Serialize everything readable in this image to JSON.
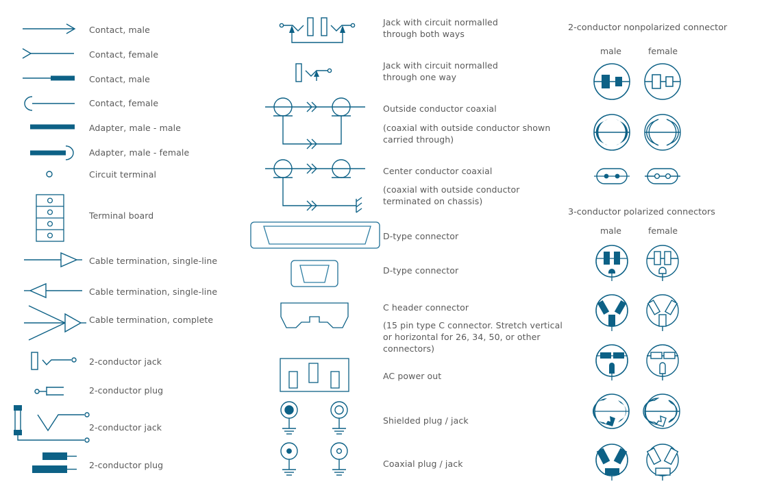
{
  "palette": {
    "symbol_stroke": "#0d6186",
    "symbol_fill": "#0d6186",
    "text": "#595959",
    "background": "#ffffff"
  },
  "column1": {
    "items": [
      {
        "label": "Contact, male",
        "icon": "contact-male-arrow-icon"
      },
      {
        "label": "Contact, female",
        "icon": "contact-female-arrow-icon"
      },
      {
        "label": "Contact, male",
        "icon": "contact-male-bar-icon"
      },
      {
        "label": "Contact, female",
        "icon": "contact-female-arc-icon"
      },
      {
        "label": "Adapter, male - male",
        "icon": "adapter-male-male-icon"
      },
      {
        "label": "Adapter, male - female",
        "icon": "adapter-male-female-icon"
      },
      {
        "label": "Circuit terminal",
        "icon": "circuit-terminal-icon"
      },
      {
        "label": "Terminal board",
        "icon": "terminal-board-icon"
      },
      {
        "label": "Cable termination, single-line",
        "icon": "cable-termination-right-icon"
      },
      {
        "label": "Cable termination, single-line",
        "icon": "cable-termination-left-icon"
      },
      {
        "label": "Cable termination, complete",
        "icon": "cable-termination-complete-icon"
      },
      {
        "label": "2-conductor jack",
        "icon": "two-conductor-jack-small-icon"
      },
      {
        "label": "2-conductor plug",
        "icon": "two-conductor-plug-small-icon"
      },
      {
        "label": "2-conductor jack",
        "icon": "two-conductor-jack-large-icon"
      },
      {
        "label": "2-conductor plug",
        "icon": "two-conductor-plug-large-icon"
      }
    ]
  },
  "column2": {
    "items": [
      {
        "label": "Jack with circuit normalled\nthrough both ways",
        "icon": "jack-normalled-both-ways-icon"
      },
      {
        "label": "Jack with circuit normalled\nthrough one way",
        "icon": "jack-normalled-one-way-icon"
      },
      {
        "label": "Outside conductor coaxial",
        "icon": "outside-conductor-coaxial-icon"
      },
      {
        "label": "(coaxial with outside conductor shown\ncarried through)",
        "icon": ""
      },
      {
        "label": "Center conductor coaxial",
        "icon": "center-conductor-coaxial-icon"
      },
      {
        "label": "(coaxial with outside conductor\nterminated on chassis)",
        "icon": ""
      },
      {
        "label": "D-type connector",
        "icon": "d-type-connector-wide-icon"
      },
      {
        "label": "D-type connector",
        "icon": "d-type-connector-small-icon"
      },
      {
        "label": "C header connector",
        "icon": "c-header-connector-icon"
      },
      {
        "label": "(15 pin type C connector. Stretch vertical\nor horizontal for 26, 34, 50, or other\nconnectors)",
        "icon": ""
      },
      {
        "label": "AC power out",
        "icon": "ac-power-out-icon"
      },
      {
        "label": "Shielded plug / jack",
        "icon": "shielded-plug-jack-icon"
      },
      {
        "label": "Coaxial plug / jack",
        "icon": "coaxial-plug-jack-icon"
      }
    ]
  },
  "column3": {
    "group1": {
      "title": "2-conductor nonpolarized connector",
      "male_label": "male",
      "female_label": "female",
      "rows": [
        {
          "male_icon": "nonpolarized-blade-male-icon",
          "female_icon": "nonpolarized-blade-female-icon"
        },
        {
          "male_icon": "nonpolarized-curved-male-icon",
          "female_icon": "nonpolarized-curved-female-icon"
        },
        {
          "male_icon": "nonpolarized-pin-male-icon",
          "female_icon": "nonpolarized-pin-female-icon"
        }
      ]
    },
    "group2": {
      "title": "3-conductor polarized connectors",
      "male_label": "male",
      "female_label": "female",
      "rows": [
        {
          "male_icon": "polarized-straight-male-icon",
          "female_icon": "polarized-straight-female-icon"
        },
        {
          "male_icon": "polarized-angled-male-icon",
          "female_icon": "polarized-angled-female-icon"
        },
        {
          "male_icon": "polarized-flat-male-icon",
          "female_icon": "polarized-flat-female-icon"
        },
        {
          "male_icon": "polarized-twist-male-icon",
          "female_icon": "polarized-twist-female-icon"
        },
        {
          "male_icon": "polarized-tri-male-icon",
          "female_icon": "polarized-tri-female-icon"
        }
      ]
    }
  }
}
